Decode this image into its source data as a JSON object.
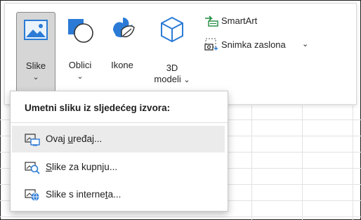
{
  "ribbon": {
    "slike": {
      "label": "Slike",
      "chevron": "⌄"
    },
    "oblici": {
      "label": "Oblici",
      "chevron": "⌄"
    },
    "ikone": {
      "label": "Ikone"
    },
    "modeli3d": {
      "line1": "3D",
      "line2": "modeli",
      "chevron": "⌄"
    },
    "smartart": {
      "label": "SmartArt"
    },
    "snimka": {
      "label": "Snimka zaslona",
      "chevron": "⌄"
    }
  },
  "menu": {
    "header": "Umetni sliku iz sljedećeg izvora:",
    "items": [
      {
        "pre": "Ovaj ",
        "u": "u",
        "post": "ređaj...",
        "icon": "this-device-icon"
      },
      {
        "pre": "",
        "u": "S",
        "post": "like za kupnju...",
        "icon": "stock-images-icon"
      },
      {
        "pre": "Slike s interne",
        "u": "t",
        "post": "a...",
        "icon": "online-pictures-icon"
      }
    ]
  },
  "colors": {
    "accent": "#2b7bd6",
    "selected_bg": "#d6d6d6",
    "hover_bg": "#ebebeb",
    "smartart_green": "#1e8a3e"
  }
}
